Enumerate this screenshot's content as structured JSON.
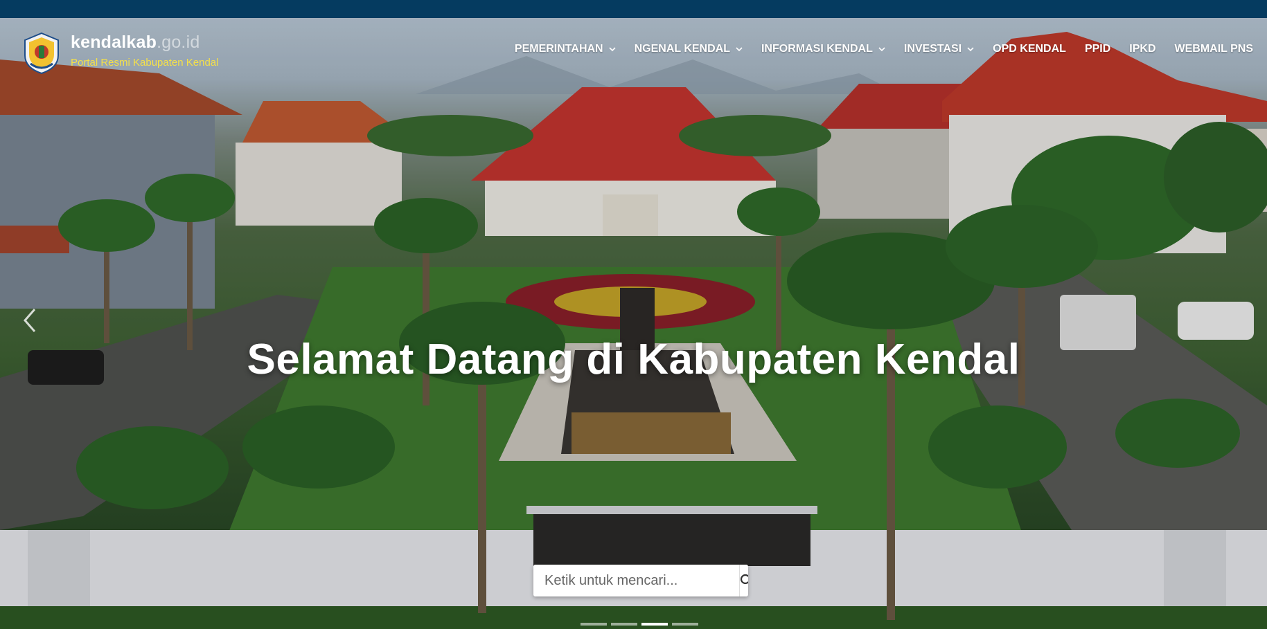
{
  "brand": {
    "name": "kendalkab",
    "domain": ".go.id",
    "tagline": "Portal Resmi Kabupaten Kendal"
  },
  "nav": {
    "items": [
      {
        "label": "PEMERINTAHAN",
        "dropdown": true
      },
      {
        "label": "NGENAL KENDAL",
        "dropdown": true
      },
      {
        "label": "INFORMASI KENDAL",
        "dropdown": true
      },
      {
        "label": "INVESTASI",
        "dropdown": true
      },
      {
        "label": "OPD KENDAL",
        "dropdown": false
      },
      {
        "label": "PPID",
        "dropdown": false
      },
      {
        "label": "IPKD",
        "dropdown": false
      },
      {
        "label": "WEBMAIL PNS",
        "dropdown": false
      }
    ]
  },
  "hero": {
    "headline": "Selamat Datang di Kabupaten Kendal",
    "prev_icon": "chevron-left-icon"
  },
  "search": {
    "placeholder": "Ketik untuk mencari...",
    "value": "",
    "icon": "search-icon"
  },
  "carousel": {
    "slides": 4,
    "active_index": 2
  },
  "colors": {
    "topbar": "#053b60",
    "tagline": "#f4e04a",
    "roof": "#b8322c"
  }
}
